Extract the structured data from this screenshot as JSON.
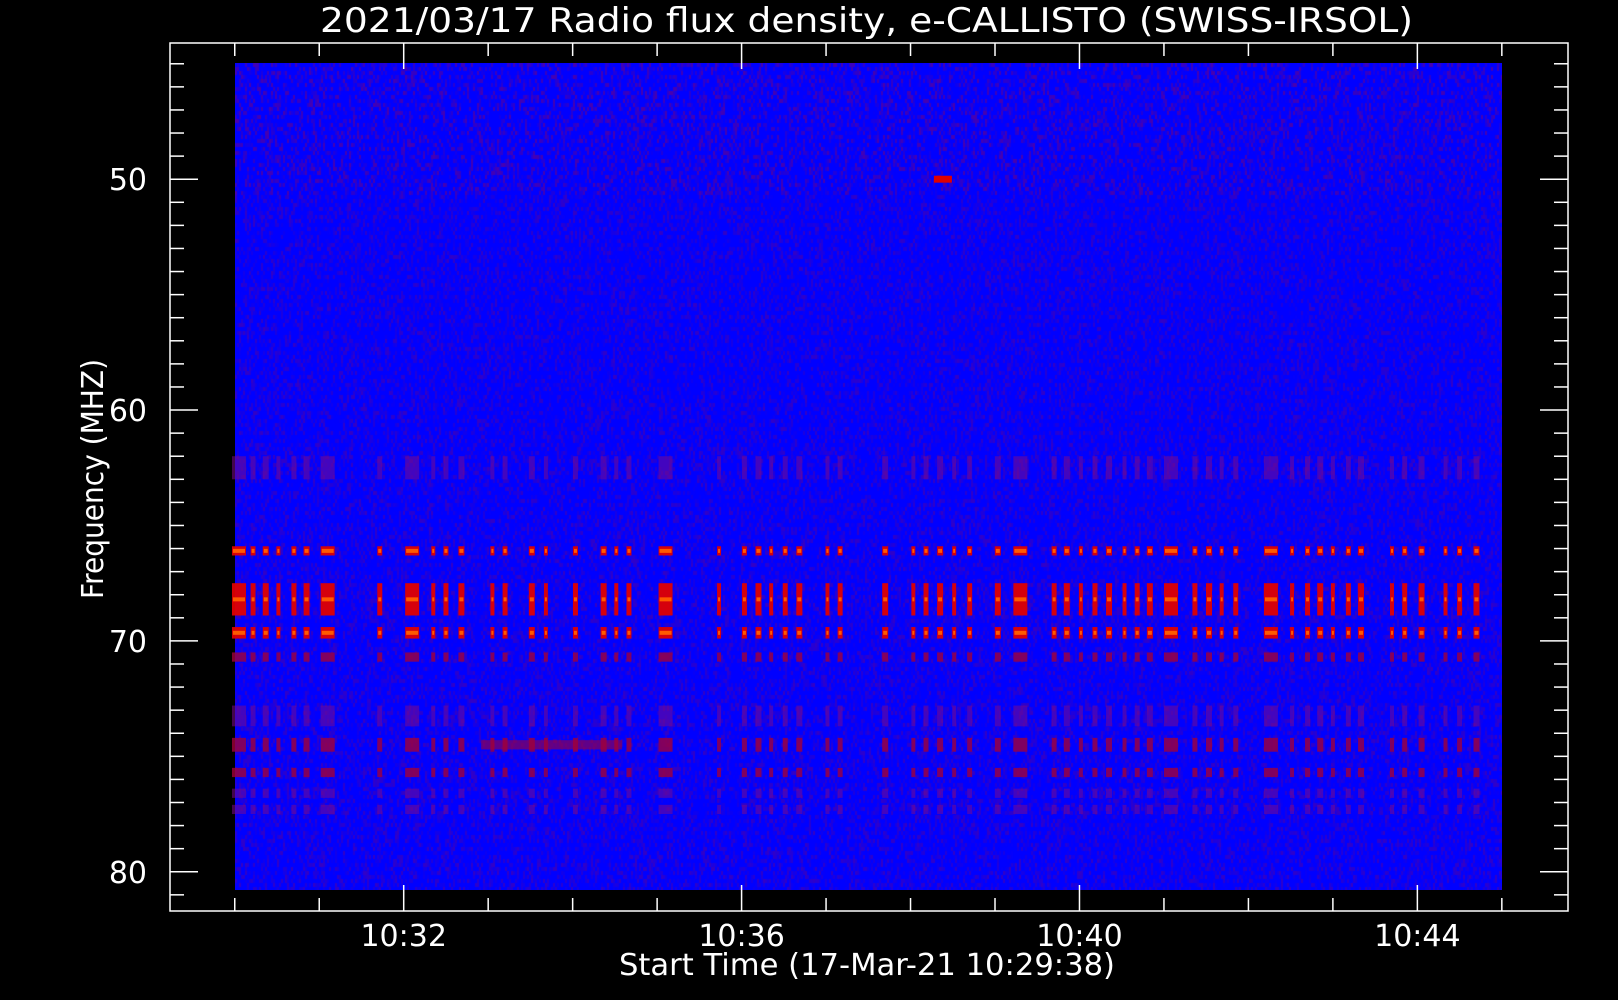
{
  "chart_data": {
    "type": "heatmap",
    "title": "2021/03/17  Radio flux density, e-CALLISTO (SWISS-IRSOL)",
    "xlabel": "Start Time (17-Mar-21 10:29:38)",
    "ylabel": "Frequency (MHZ)",
    "x_ticks": [
      "10:32",
      "10:36",
      "10:40",
      "10:44"
    ],
    "y_ticks": [
      50,
      60,
      70,
      80
    ],
    "xlim": [
      "10:29:14",
      "10:45:47"
    ],
    "ylim": [
      44.1,
      81.7
    ],
    "y_axis": "inverted",
    "grid": false,
    "data_extent": {
      "time": [
        "10:30:00",
        "10:45:00"
      ],
      "freq": [
        45.0,
        80.8
      ]
    },
    "colormap": {
      "low": "#0000ff",
      "mid": "#7a0a8a",
      "high": "#e00000",
      "peak": "#ff5a00"
    },
    "burst_times": [
      "10:30:03",
      "10:30:13",
      "10:30:22",
      "10:30:31",
      "10:30:42",
      "10:30:51",
      "10:31:06",
      "10:31:43",
      "10:32:06",
      "10:32:21",
      "10:32:30",
      "10:32:41",
      "10:33:03",
      "10:33:12",
      "10:33:31",
      "10:33:41",
      "10:34:02",
      "10:34:22",
      "10:34:31",
      "10:34:40",
      "10:35:06",
      "10:35:44",
      "10:36:02",
      "10:36:12",
      "10:36:21",
      "10:36:31",
      "10:36:41",
      "10:37:01",
      "10:37:10",
      "10:37:42",
      "10:38:02",
      "10:38:11",
      "10:38:21",
      "10:38:31",
      "10:38:42",
      "10:39:02",
      "10:39:18",
      "10:39:42",
      "10:39:51",
      "10:40:01",
      "10:40:11",
      "10:40:21",
      "10:40:32",
      "10:40:41",
      "10:40:50",
      "10:41:05",
      "10:41:22",
      "10:41:32",
      "10:41:41",
      "10:41:51",
      "10:42:16",
      "10:42:31",
      "10:42:42",
      "10:42:51",
      "10:43:00",
      "10:43:11",
      "10:43:20",
      "10:43:42",
      "10:43:51",
      "10:44:03",
      "10:44:20",
      "10:44:30",
      "10:44:42"
    ],
    "wide_bursts": [
      "10:30:03",
      "10:31:06",
      "10:32:06",
      "10:35:06",
      "10:39:18",
      "10:41:05",
      "10:42:16"
    ],
    "bands": [
      {
        "freq": [
          62.0,
          63.0
        ],
        "intensity": "low"
      },
      {
        "freq": [
          65.9,
          66.3
        ],
        "intensity": "high"
      },
      {
        "freq": [
          67.5,
          68.9
        ],
        "intensity": "high"
      },
      {
        "freq": [
          69.4,
          69.9
        ],
        "intensity": "high"
      },
      {
        "freq": [
          70.5,
          70.9
        ],
        "intensity": "medium"
      },
      {
        "freq": [
          72.8,
          73.7
        ],
        "intensity": "low"
      },
      {
        "freq": [
          74.2,
          74.8
        ],
        "intensity": "medium"
      },
      {
        "freq": [
          75.5,
          75.9
        ],
        "intensity": "medium"
      },
      {
        "freq": [
          76.4,
          76.8
        ],
        "intensity": "low"
      },
      {
        "freq": [
          77.1,
          77.5
        ],
        "intensity": "low"
      }
    ],
    "interference": [
      {
        "time": [
          "10:32:55",
          "10:34:35"
        ],
        "freq": [
          74.3,
          74.7
        ],
        "intensity": "medium"
      }
    ],
    "spot": {
      "time": "10:38:23",
      "freq": [
        49.85,
        50.15
      ],
      "intensity": "high"
    }
  }
}
